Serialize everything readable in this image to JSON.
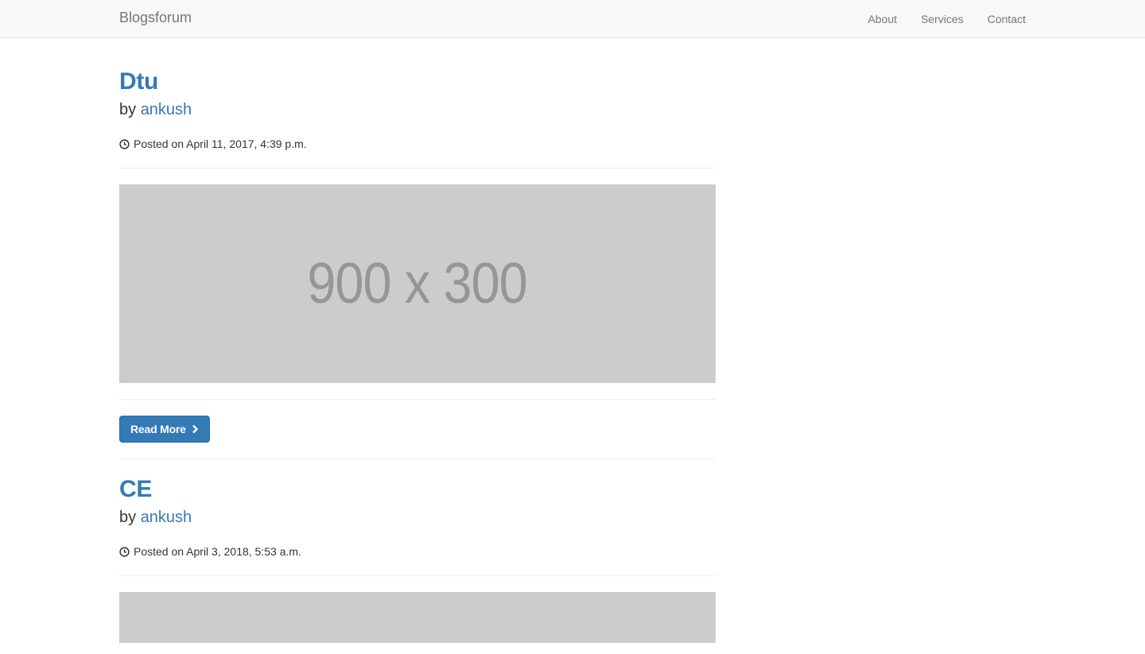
{
  "navbar": {
    "brand": "Blogsforum",
    "links": [
      "About",
      "Services",
      "Contact"
    ]
  },
  "posts": [
    {
      "title": "Dtu",
      "by_prefix": "by",
      "author": "ankush",
      "posted": "Posted on April 11, 2017, 4:39 p.m.",
      "image_text": "900 x 300",
      "button_label": "Read More"
    },
    {
      "title": "CE",
      "by_prefix": "by",
      "author": "ankush",
      "posted": "Posted on April 3, 2018, 5:53 a.m."
    }
  ],
  "colors": {
    "link": "#337ab7",
    "navbar_bg": "#f8f8f8",
    "placeholder_bg": "#cccccc"
  },
  "icons": [
    "clock-icon",
    "chevron-right-icon"
  ]
}
